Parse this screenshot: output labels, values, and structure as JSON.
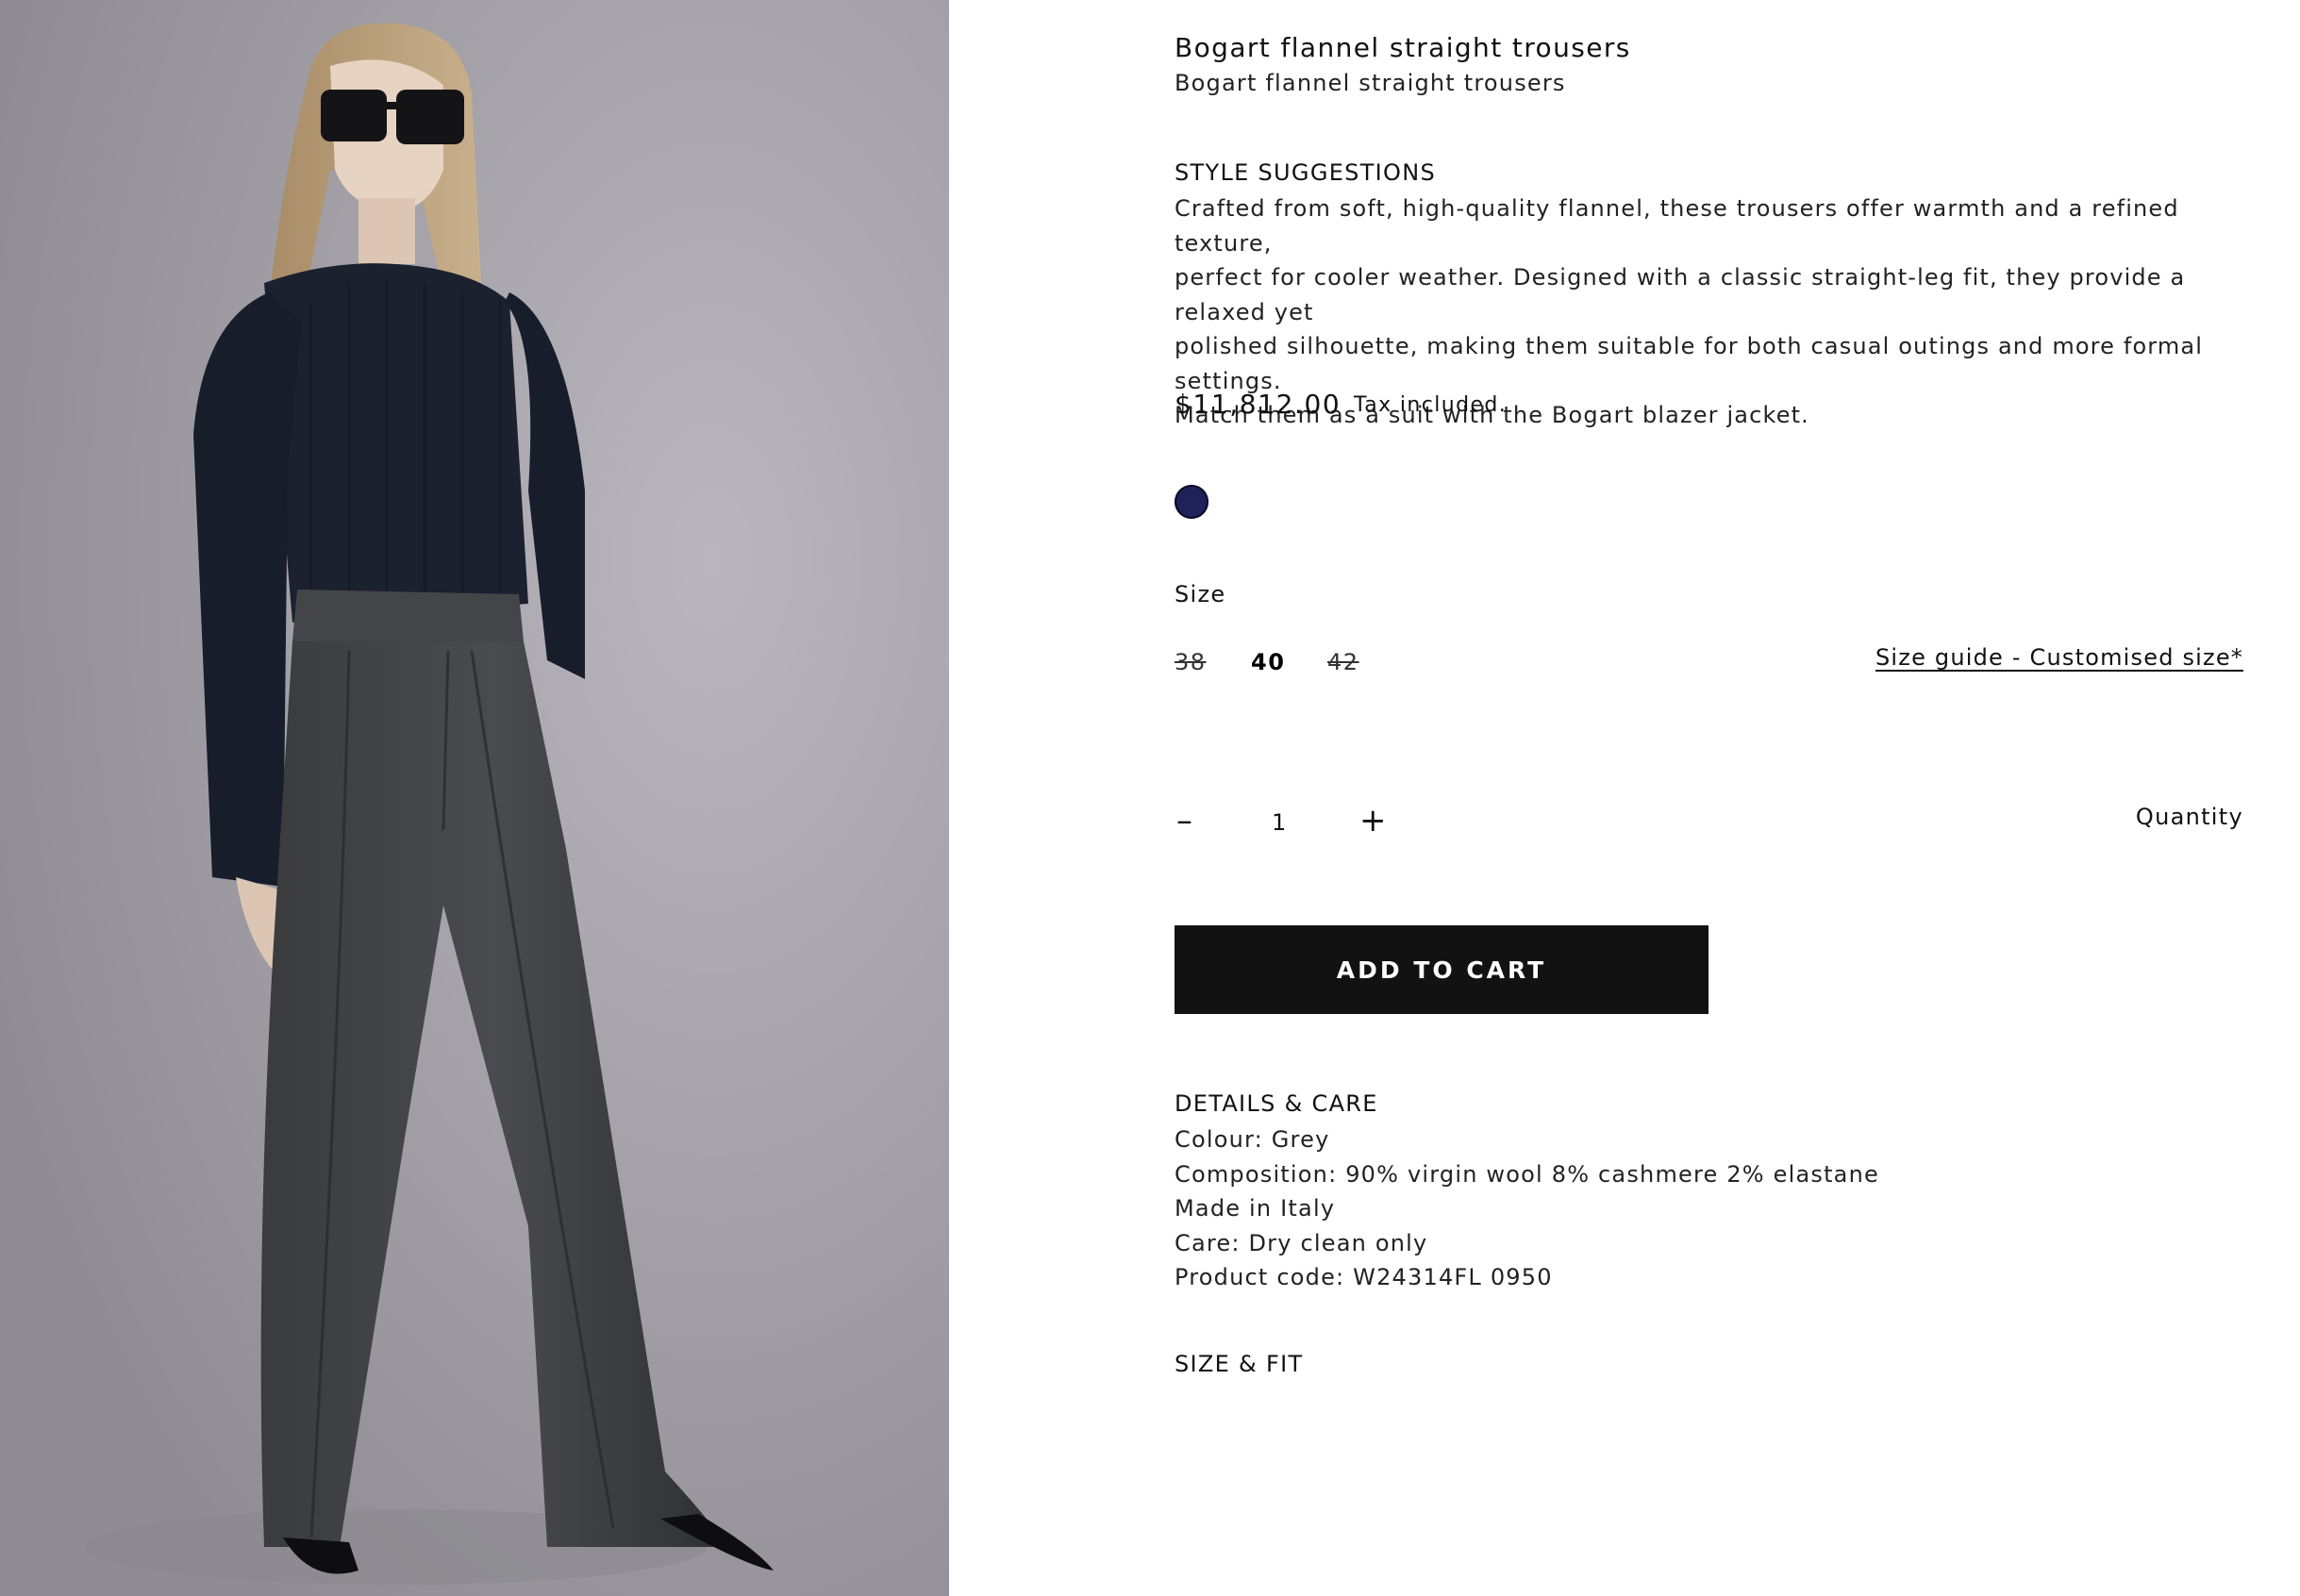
{
  "product": {
    "title": "Bogart flannel straight trousers",
    "subtitle": "Bogart flannel straight trousers"
  },
  "style_suggestions": {
    "heading": "STYLE SUGGESTIONS",
    "lines": [
      "Crafted from soft, high-quality flannel, these trousers offer warmth and a refined texture,",
      "perfect for cooler weather. Designed with a classic straight-leg fit, they provide a relaxed yet",
      "polished silhouette, making them suitable for both casual outings and more formal settings.",
      "Match them as a suit with the Bogart blazer jacket."
    ]
  },
  "pricing": {
    "price": "$11,812.00",
    "tax_note": "Tax included."
  },
  "colour_swatch": {
    "color": "#1e2258"
  },
  "size": {
    "label": "Size",
    "options": [
      {
        "label": "38",
        "available": false
      },
      {
        "label": "40",
        "available": true,
        "selected": true
      },
      {
        "label": "42",
        "available": false
      }
    ],
    "guide_link": "Size guide - Customised size*"
  },
  "quantity": {
    "label": "Quantity",
    "value": "1",
    "minus_symbol": "–",
    "plus_symbol": "+"
  },
  "cart": {
    "button_label": "ADD TO CART"
  },
  "details": {
    "heading": "DETAILS & CARE",
    "items": [
      "Colour: Grey",
      "Composition: 90% virgin wool 8% cashmere 2% elastane",
      "Made in Italy",
      "Care: Dry clean only",
      "Product code: W24314FL 0950"
    ]
  },
  "size_fit": {
    "heading": "SIZE & FIT"
  },
  "photo": {
    "subject": "model wearing navy knit sweater, grey wide-leg trousers and black sunglasses"
  }
}
